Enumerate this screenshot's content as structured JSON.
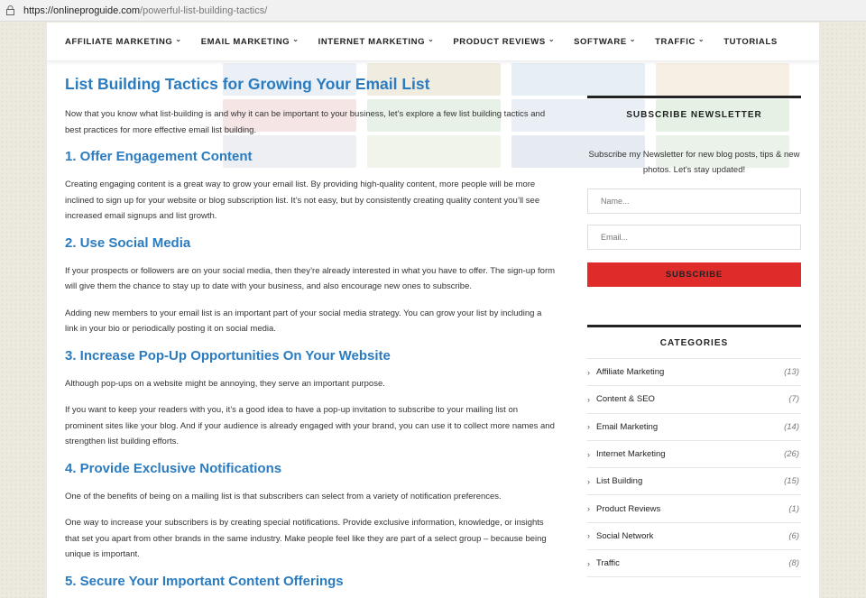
{
  "browser": {
    "url_host": "https://onlineproguide.com",
    "url_path": "/powerful-list-building-tactics/"
  },
  "nav": {
    "items": [
      {
        "label": "AFFILIATE MARKETING",
        "dropdown": true
      },
      {
        "label": "EMAIL MARKETING",
        "dropdown": true
      },
      {
        "label": "INTERNET MARKETING",
        "dropdown": true
      },
      {
        "label": "PRODUCT REVIEWS",
        "dropdown": true
      },
      {
        "label": "SOFTWARE",
        "dropdown": true
      },
      {
        "label": "TRAFFIC",
        "dropdown": true
      },
      {
        "label": "TUTORIALS",
        "dropdown": false
      }
    ]
  },
  "article": {
    "title": "List Building Tactics for Growing Your Email List",
    "intro": "Now that you know what list-building is and why it can be important to your business, let’s explore a few list building tactics and best practices for more effective email list building.",
    "sections": [
      {
        "heading": "1. Offer Engagement Content",
        "paragraphs": [
          "Creating engaging content is a great way to grow your email list. By providing high-quality content, more people will be more inclined to sign up for your website or blog subscription list. It’s not easy, but by consistently creating quality content you’ll see increased email signups and list growth."
        ]
      },
      {
        "heading": "2. Use Social Media",
        "paragraphs": [
          "If your prospects or followers are on your social media, then they’re already interested in what you have to offer. The sign-up form will give them the chance to stay up to date with your business, and also encourage new ones to subscribe.",
          "Adding new members to your email list is an important part of your social media strategy. You can grow your list by including a link in your bio or periodically posting it on social media."
        ]
      },
      {
        "heading": "3. Increase Pop-Up Opportunities On Your Website",
        "paragraphs": [
          "Although pop-ups on a website might be annoying, they serve an important purpose.",
          "If you want to keep your readers with you, it’s a good idea to have a pop-up invitation to subscribe to your mailing list on prominent sites like your blog. And if your audience is already engaged with your brand, you can use it to collect more names and strengthen list building efforts."
        ]
      },
      {
        "heading": "4. Provide Exclusive Notifications",
        "paragraphs": [
          "One of the benefits of being on a mailing list is that subscribers can select from a variety of notification preferences.",
          "One way to increase your subscribers is by creating special notifications. Provide exclusive information, knowledge, or insights that set you apart from other brands in the same industry. Make people feel like they are part of a select group – because being unique is important."
        ]
      },
      {
        "heading": "5. Secure Your Important Content Offerings",
        "paragraphs": []
      }
    ]
  },
  "newsletter": {
    "title": "SUBSCRIBE NEWSLETTER",
    "text": "Subscribe my Newsletter for new blog posts, tips & new photos. Let's stay updated!",
    "name_placeholder": "Name...",
    "email_placeholder": "Email...",
    "button_label": "SUBSCRIBE",
    "button_color": "#e02b2b"
  },
  "categories": {
    "title": "CATEGORIES",
    "items": [
      {
        "name": "Affiliate Marketing",
        "count": "(13)"
      },
      {
        "name": "Content & SEO",
        "count": "(7)"
      },
      {
        "name": "Email Marketing",
        "count": "(14)"
      },
      {
        "name": "Internet Marketing",
        "count": "(26)"
      },
      {
        "name": "List Building",
        "count": "(15)"
      },
      {
        "name": "Product Reviews",
        "count": "(1)"
      },
      {
        "name": "Social Network",
        "count": "(6)"
      },
      {
        "name": "Traffic",
        "count": "(8)"
      }
    ]
  },
  "colors": {
    "heading_blue": "#2a7bbf",
    "accent_red": "#e02b2b"
  }
}
